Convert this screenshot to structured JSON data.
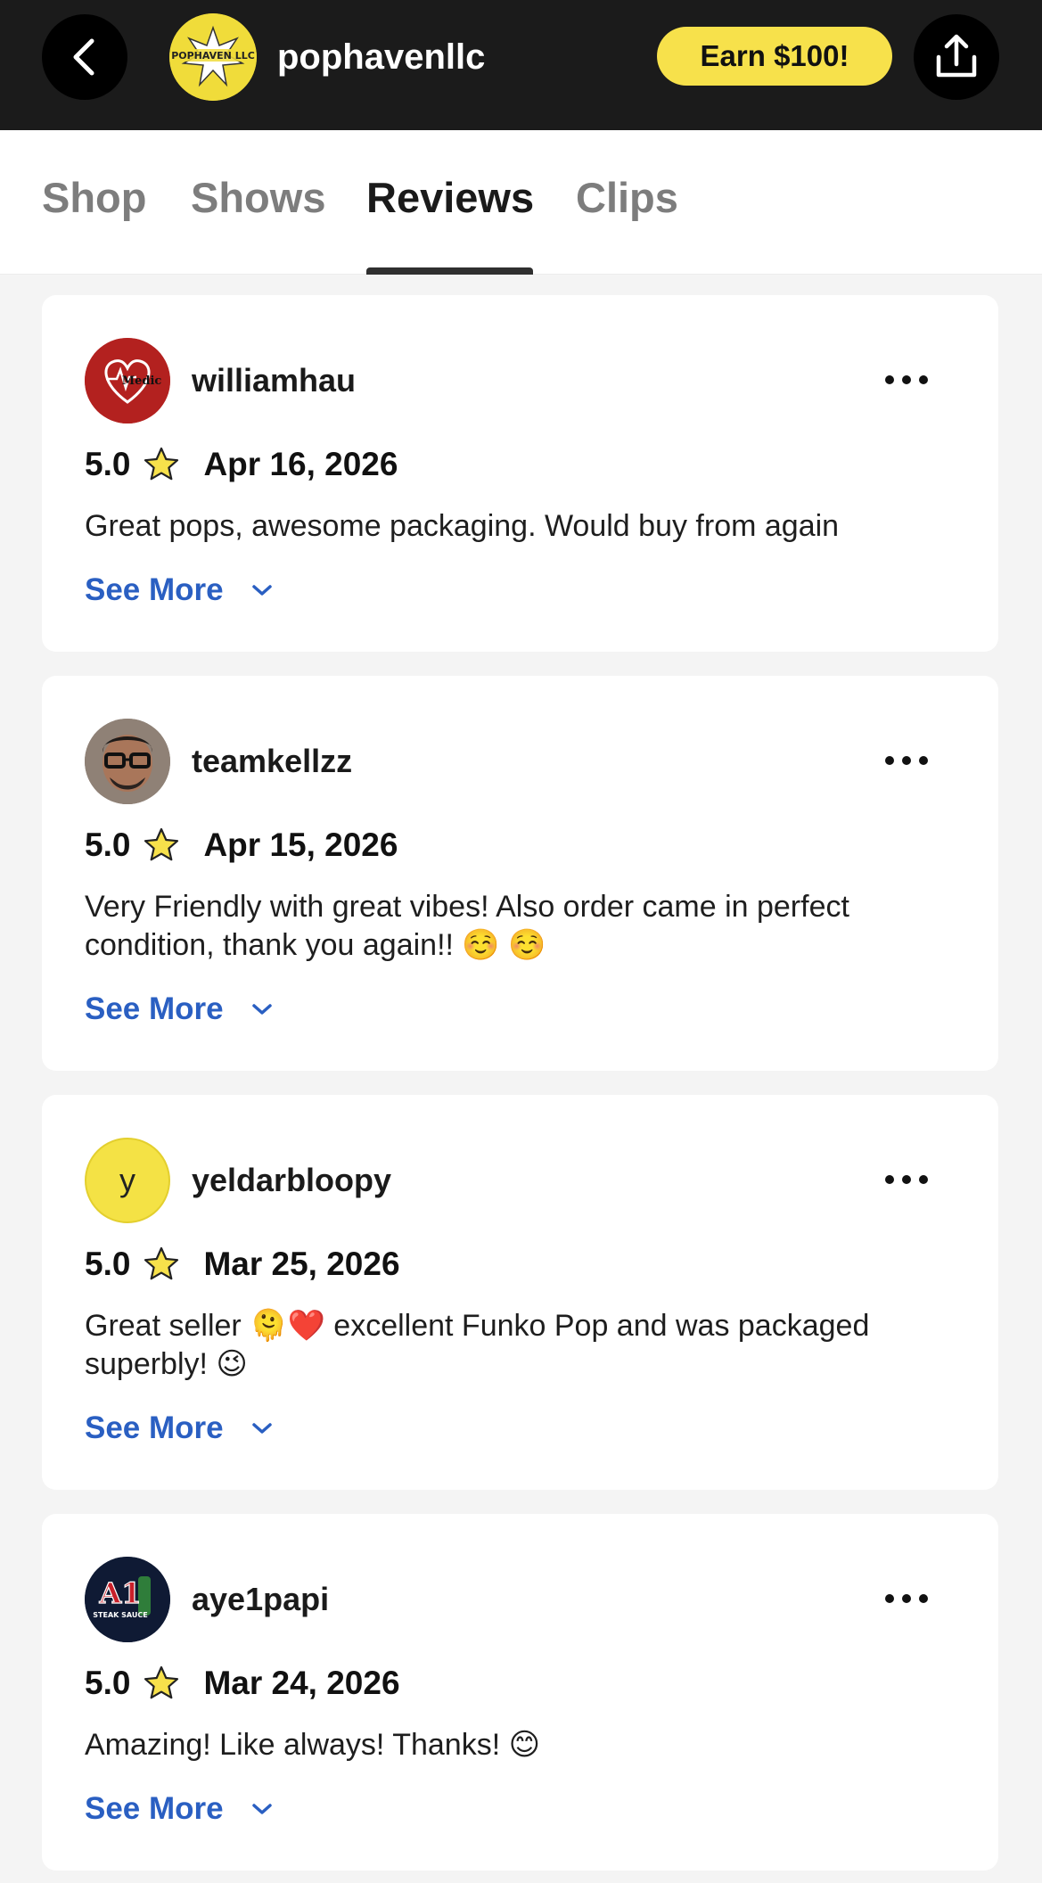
{
  "header": {
    "shop_name": "pophavenllc",
    "shop_logo_text": "POPHAVEN LLC",
    "earn_label": "Earn $100!",
    "back_icon": "chevron-left-icon",
    "share_icon": "share-icon",
    "accent_color": "#f7e14b"
  },
  "tabs": [
    {
      "label": "Shop",
      "active": false
    },
    {
      "label": "Shows",
      "active": false
    },
    {
      "label": "Reviews",
      "active": true
    },
    {
      "label": "Clips",
      "active": false
    }
  ],
  "reviews": [
    {
      "username": "williamhau",
      "avatar_text": "Medic",
      "rating": "5.0",
      "date": "Apr 16, 2026",
      "text": "Great pops, awesome packaging. Would buy from again",
      "see_more": "See More"
    },
    {
      "username": "teamkellzz",
      "rating": "5.0",
      "date": "Apr 15, 2026",
      "text": "Very Friendly with great vibes! Also order came in perfect condition, thank you again!! ☺️ ☺️",
      "see_more": "See More"
    },
    {
      "username": "yeldarbloopy",
      "avatar_letter": "y",
      "rating": "5.0",
      "date": "Mar 25, 2026",
      "text": "Great seller 🫠❤️ excellent Funko Pop and was packaged superbly! 😉",
      "see_more": "See More"
    },
    {
      "username": "aye1papi",
      "avatar_text": "A1",
      "avatar_subtext": "STEAK SAUCE",
      "rating": "5.0",
      "date": "Mar 24, 2026",
      "text": "Amazing! Like always! Thanks! 😊",
      "see_more": "See More"
    }
  ],
  "colors": {
    "link": "#2a5fc2",
    "star_fill": "#f7e14b",
    "header_bg": "#1b1b1b"
  }
}
